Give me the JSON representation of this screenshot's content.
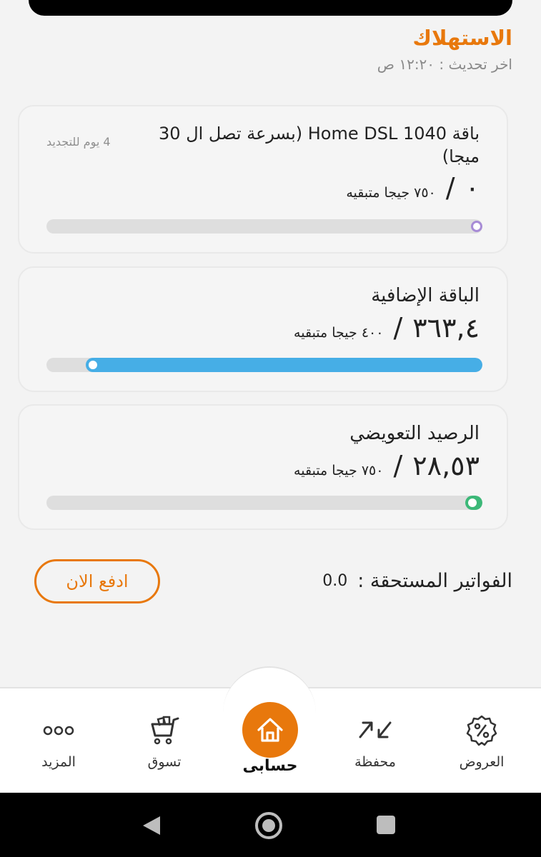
{
  "header": {
    "title": "الاستهلاك",
    "last_updated": "اخر تحديث : ١٢:٢٠ ص"
  },
  "plans": [
    {
      "name": "باقة Home DSL 1040 (بسرعة تصل ال 30 ميجا)",
      "renewal": "4 يوم للتجديد",
      "used": "٠",
      "total": "٧٥٠ جيجا متبقيه",
      "fill_fraction": 0.0,
      "color": "#a78bd6"
    },
    {
      "name": "الباقة الإضافية",
      "used": "٣٦٣,٤",
      "total": "٤٠٠ جيجا متبقيه",
      "fill_fraction": 0.91,
      "color": "#46aee6"
    },
    {
      "name": "الرصيد التعويضي",
      "used": "٢٨,٥٣",
      "total": "٧٥٠ جيجا متبقيه",
      "fill_fraction": 0.04,
      "color": "#3cb878"
    }
  ],
  "bills": {
    "label": "الفواتير المستحقة :",
    "amount": "0.0",
    "pay_label": "ادفع الان"
  },
  "nav": {
    "offers": "العروض",
    "wallet": "محفظة",
    "account": "حسابى",
    "shop": "تسوق",
    "more": "المزيد"
  },
  "colors": {
    "accent": "#e8780c"
  }
}
